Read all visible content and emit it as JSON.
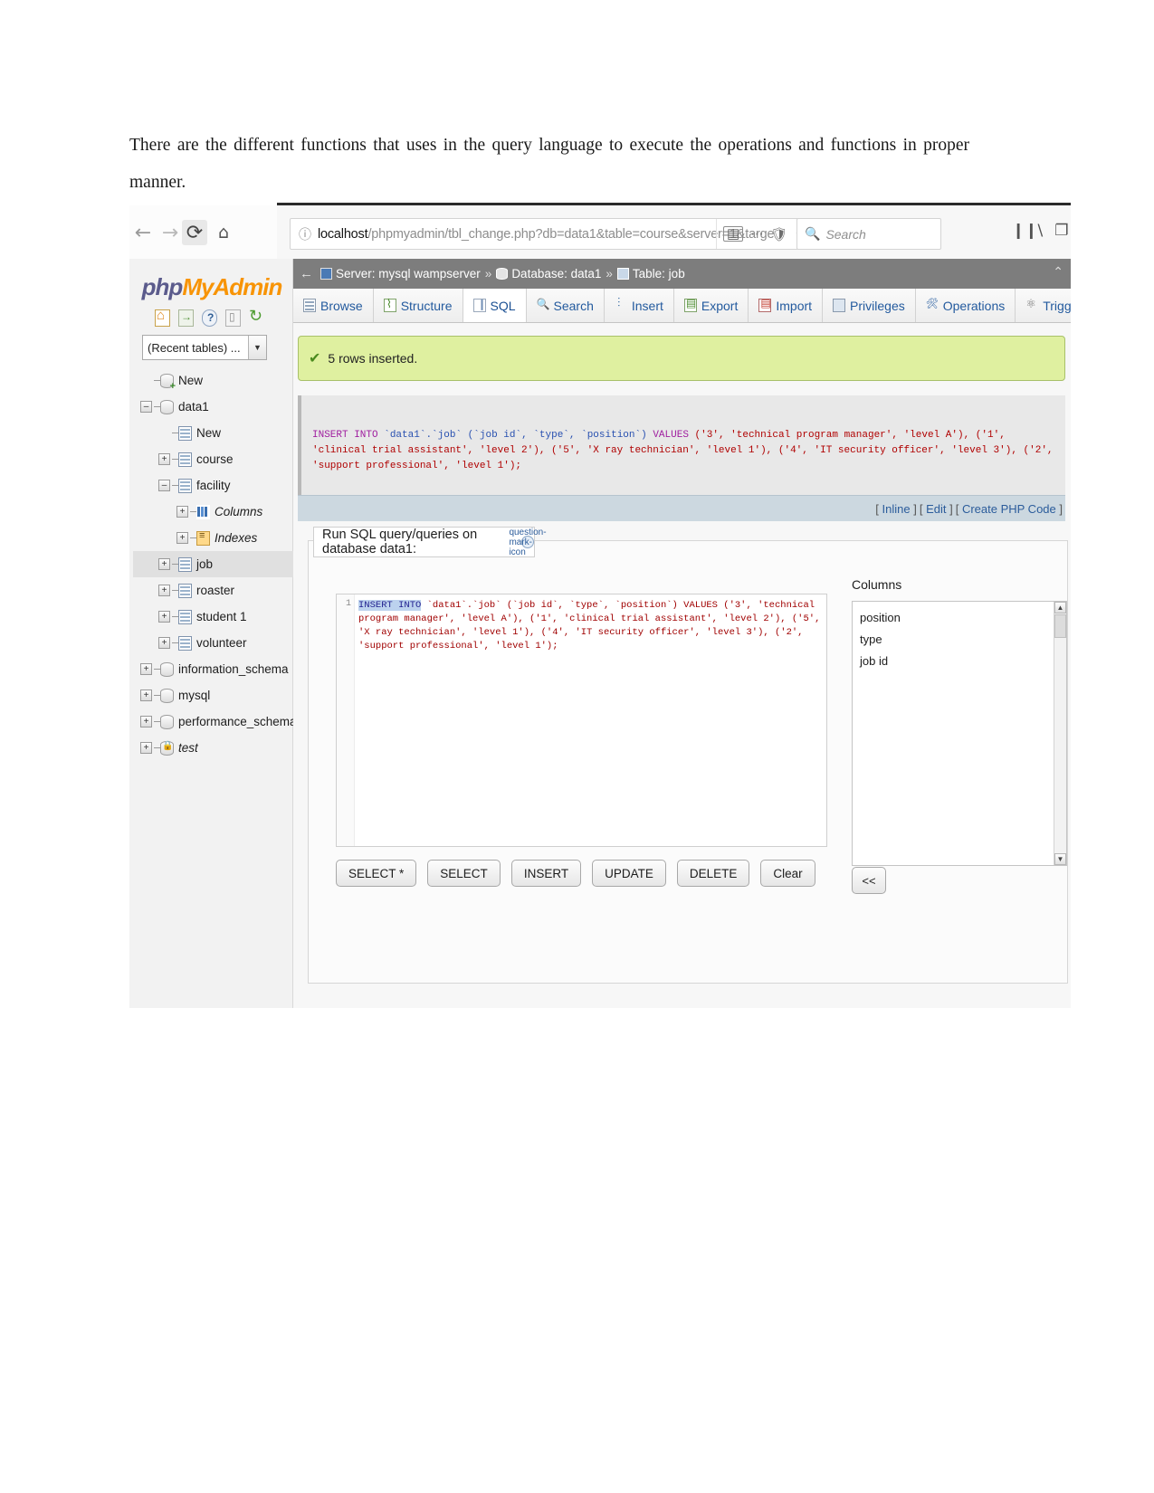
{
  "document": {
    "paragraph": "There are the different functions that uses in the query language to execute the operations and functions in proper manner."
  },
  "browser": {
    "nav": {
      "back_icon": "arrow-left",
      "forward_icon": "arrow-right",
      "reload_icon": "reload",
      "home_icon": "home"
    },
    "url": {
      "host": "localhost",
      "path": "/phpmyadmin/tbl_change.php?db=data1&table=course&server=1&targe",
      "full": "localhost/phpmyadmin/tbl_change.php?db=data1&table=course&server=1&targe",
      "info_icon": "info-circle",
      "reader_icon": "reader-view-icon",
      "menu_icon": "ellipsis-icon",
      "shield_icon": "shield-icon",
      "bookmark_icon": "star-icon"
    },
    "search": {
      "placeholder": "Search",
      "icon": "search-icon"
    },
    "right_icons": [
      "library-icon",
      "sidebar-icon"
    ],
    "kebab_icon": "vertical-ellipsis-icon"
  },
  "pma": {
    "logo": {
      "php": "php",
      "my": "My",
      "admin": "Admin"
    },
    "side_icons": [
      "home-icon",
      "logout-icon",
      "docs-icon",
      "console-icon",
      "reload-icon"
    ],
    "recent_tables": {
      "label": "(Recent tables) ...",
      "arrow": "▼"
    },
    "tree": [
      {
        "label": "New",
        "depth": 0,
        "toggle": "",
        "icon": "db-new",
        "italic": false,
        "selected": false
      },
      {
        "label": "data1",
        "depth": 0,
        "toggle": "–",
        "icon": "db",
        "italic": false,
        "selected": false
      },
      {
        "label": "New",
        "depth": 1,
        "toggle": "",
        "icon": "tbl-new",
        "italic": false,
        "selected": false
      },
      {
        "label": "course",
        "depth": 1,
        "toggle": "+",
        "icon": "tbl",
        "italic": false,
        "selected": false
      },
      {
        "label": "facility",
        "depth": 1,
        "toggle": "–",
        "icon": "tbl",
        "italic": false,
        "selected": false
      },
      {
        "label": "Columns",
        "depth": 2,
        "toggle": "+",
        "icon": "cols",
        "italic": true,
        "selected": false
      },
      {
        "label": "Indexes",
        "depth": 2,
        "toggle": "+",
        "icon": "idx",
        "italic": true,
        "selected": false
      },
      {
        "label": "job",
        "depth": 1,
        "toggle": "+",
        "icon": "tbl",
        "italic": false,
        "selected": true
      },
      {
        "label": "roaster",
        "depth": 1,
        "toggle": "+",
        "icon": "tbl",
        "italic": false,
        "selected": false
      },
      {
        "label": "student 1",
        "depth": 1,
        "toggle": "+",
        "icon": "tbl",
        "italic": false,
        "selected": false
      },
      {
        "label": "volunteer",
        "depth": 1,
        "toggle": "+",
        "icon": "tbl",
        "italic": false,
        "selected": false
      },
      {
        "label": "information_schema",
        "depth": 0,
        "toggle": "+",
        "icon": "db",
        "italic": false,
        "selected": false
      },
      {
        "label": "mysql",
        "depth": 0,
        "toggle": "+",
        "icon": "db",
        "italic": false,
        "selected": false
      },
      {
        "label": "performance_schema",
        "depth": 0,
        "toggle": "+",
        "icon": "db",
        "italic": false,
        "selected": false
      },
      {
        "label": "test",
        "depth": 0,
        "toggle": "+",
        "icon": "db-lock",
        "italic": true,
        "selected": false
      }
    ],
    "breadcrumb": {
      "back_arrow": "←",
      "server": "Server: mysql wampserver",
      "database": "Database: data1",
      "table": "Table: job",
      "separator": "»",
      "expand_icon": "chevron-up-icon"
    },
    "tabs": [
      {
        "label": "Browse",
        "icon": "browse-icon",
        "active": false
      },
      {
        "label": "Structure",
        "icon": "structure-icon",
        "active": false
      },
      {
        "label": "SQL",
        "icon": "sql-icon",
        "active": true
      },
      {
        "label": "Search",
        "icon": "search-icon",
        "active": false
      },
      {
        "label": "Insert",
        "icon": "insert-icon",
        "active": false
      },
      {
        "label": "Export",
        "icon": "export-icon",
        "active": false
      },
      {
        "label": "Import",
        "icon": "import-icon",
        "active": false
      },
      {
        "label": "Privileges",
        "icon": "privileges-icon",
        "active": false
      },
      {
        "label": "Operations",
        "icon": "operations-icon",
        "active": false
      },
      {
        "label": "Triggers",
        "icon": "triggers-icon",
        "active": false
      }
    ],
    "notice": {
      "icon": "green-check-icon",
      "text": "5 rows inserted."
    },
    "executed_sql": {
      "keyword1": "INSERT INTO",
      "target": "`data1`.`job`",
      "columns": "(`job id`, `type`, `position`)",
      "keyword2": "VALUES",
      "values": "('3', 'technical program manager', 'level A'), ('1', 'clinical trial assistant', 'level 2'), ('5', 'X ray technician', 'level 1'), ('4', 'IT security officer', 'level 3'), ('2', 'support professional', 'level 1');"
    },
    "action_links": [
      "Inline",
      "Edit",
      "Create PHP Code"
    ],
    "query_panel": {
      "title": "Run SQL query/queries on database data1:",
      "help_icon": "question-mark-icon",
      "line_number": "1",
      "editor_value_selected": "INSERT INTO",
      "editor_value_rest": " `data1`.`job` (`job id`, `type`, `position`) VALUES ('3', 'technical program manager', 'level A'), ('1', 'clinical trial assistant', 'level 2'), ('5', 'X ray technician', 'level 1'), ('4', 'IT security officer', 'level 3'), ('2', 'support professional', 'level 1');",
      "buttons": [
        "SELECT *",
        "SELECT",
        "INSERT",
        "UPDATE",
        "DELETE",
        "Clear"
      ],
      "columns_caption": "Columns",
      "columns": [
        "job id",
        "type",
        "position"
      ],
      "back_button": "<<",
      "scroll_up_icon": "▲",
      "scroll_down_icon": "▼"
    }
  },
  "colors": {
    "notice_bg": "#dff0a0",
    "breadcrumb_bg": "#7d7d7d",
    "accent_link": "#235a9e",
    "logo_orange": "#f89406",
    "logo_blue": "#5b5b8c"
  }
}
